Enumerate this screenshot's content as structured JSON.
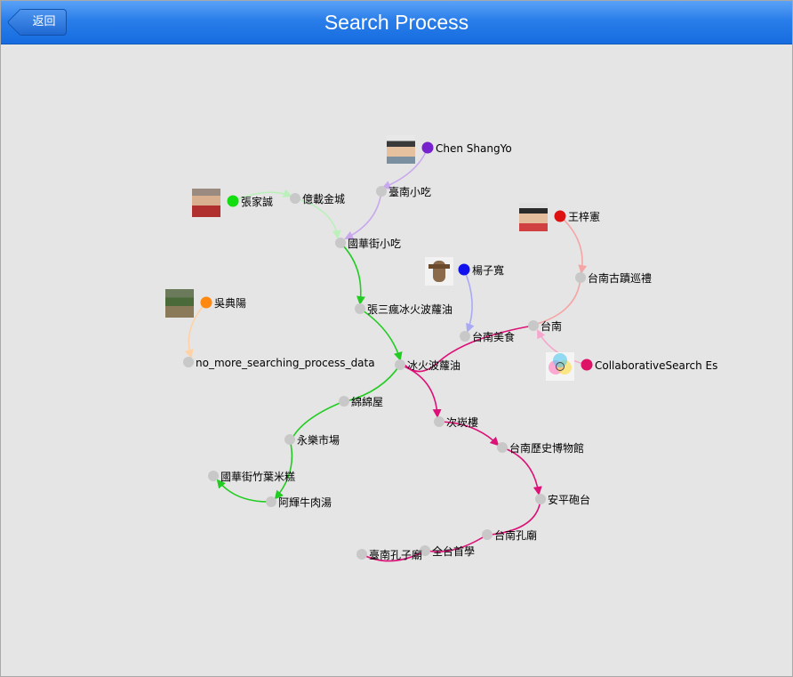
{
  "header": {
    "title": "Search Process",
    "back_label": "返回"
  },
  "users": [
    {
      "name": "Chen ShangYo",
      "color": "#7722cc",
      "edge_color": "#c9a8ee"
    },
    {
      "name": "張家誠",
      "color": "#11dd11",
      "edge_color": "#bbf0bb"
    },
    {
      "name": "王梓憲",
      "color": "#dd1111",
      "edge_color": "#f4a5a5"
    },
    {
      "name": "楊子寬",
      "color": "#1111ee",
      "edge_color": "#aaaaf4"
    },
    {
      "name": "吳典陽",
      "color": "#ff8811",
      "edge_color": "#ffd1a4"
    },
    {
      "name": "CollaborativeSearch Es",
      "color": "#dd1166",
      "edge_color": "#f6a8cc"
    }
  ],
  "nodes": [
    "臺南小吃",
    "億載金城",
    "國華街小吃",
    "張三瘋冰火波蘿油",
    "台南古蹟巡禮",
    "台南",
    "台南美食",
    "冰火波蘿油",
    "no_more_searching_process_data",
    "綿綿屋",
    "永樂市場",
    "國華街竹葉米糕",
    "阿輝牛肉湯",
    "次崁樓",
    "台南歷史博物館",
    "安平砲台",
    "台南孔廟",
    "全台首學",
    "臺南孔子廟"
  ],
  "path_colors": {
    "green": "#22cc22",
    "pink": "#dd1177",
    "node": "#c8c8c8"
  }
}
